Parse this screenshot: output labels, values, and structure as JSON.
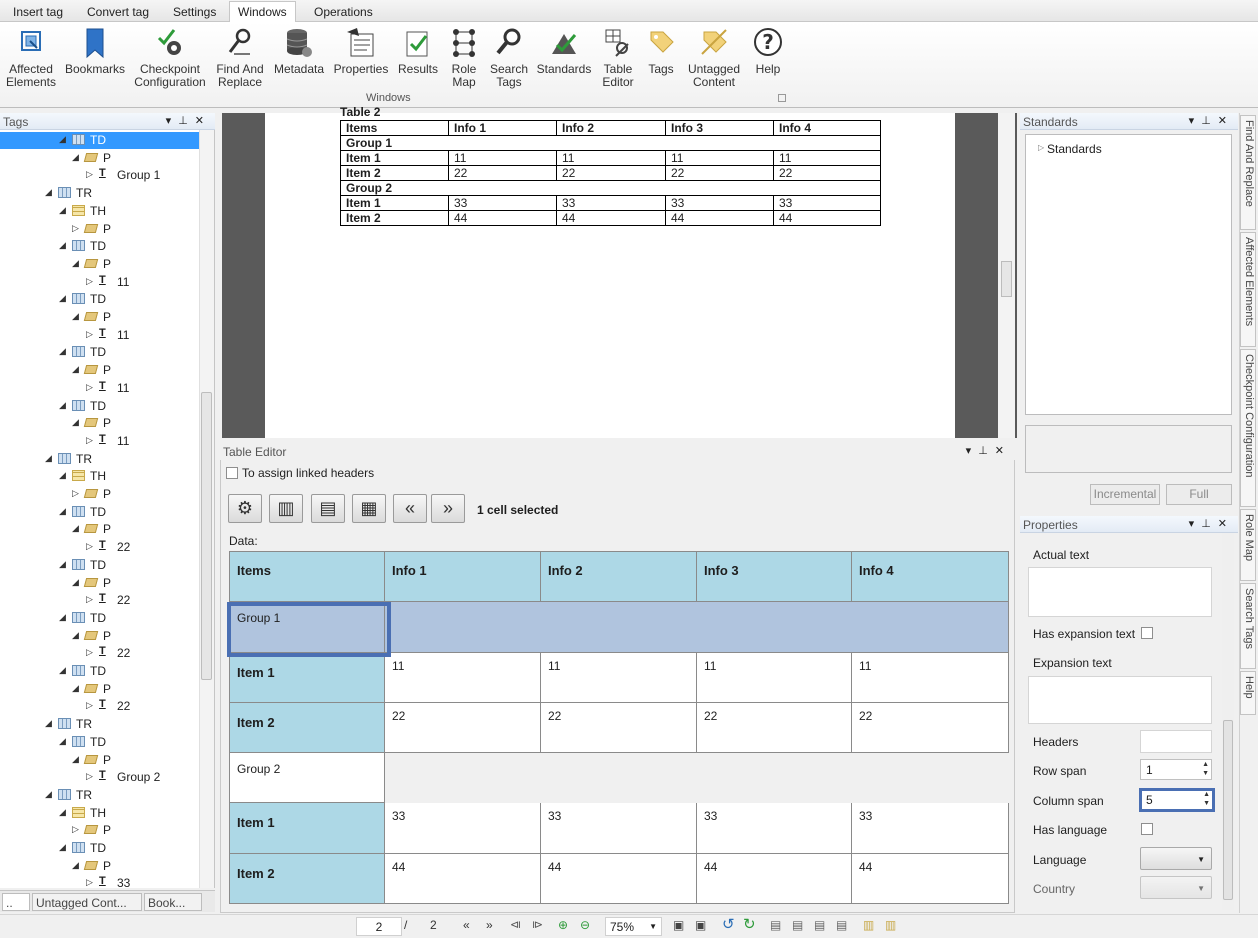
{
  "ribbon": {
    "tabs": [
      "Insert tag",
      "Convert tag",
      "Settings",
      "Windows",
      "Operations"
    ],
    "active_tab": "Windows",
    "buttons": [
      {
        "label": "Affected\nElements",
        "icon": "affected-elements-icon"
      },
      {
        "label": "Bookmarks",
        "icon": "bookmark-icon"
      },
      {
        "label": "Checkpoint\nConfiguration",
        "icon": "checkpoint-gear-icon"
      },
      {
        "label": "Find And\nReplace",
        "icon": "find-replace-icon"
      },
      {
        "label": "Metadata",
        "icon": "database-icon"
      },
      {
        "label": "Properties",
        "icon": "properties-icon"
      },
      {
        "label": "Results",
        "icon": "results-icon"
      },
      {
        "label": "Role\nMap",
        "icon": "role-map-icon"
      },
      {
        "label": "Search\nTags",
        "icon": "search-icon"
      },
      {
        "label": "Standards",
        "icon": "standards-icon"
      },
      {
        "label": "Table\nEditor",
        "icon": "table-editor-icon"
      },
      {
        "label": "Tags",
        "icon": "tags-icon"
      },
      {
        "label": "Untagged\nContent",
        "icon": "untagged-icon"
      },
      {
        "label": "Help",
        "icon": "help-icon"
      }
    ],
    "group_label": "Windows"
  },
  "tags_panel": {
    "title": "Tags",
    "rows": [
      {
        "type": "TD",
        "label": "TD",
        "level": 4,
        "expanded": true,
        "selected": true
      },
      {
        "type": "P",
        "label": "P",
        "level": 5,
        "expanded": true
      },
      {
        "type": "T",
        "label": "Group 1",
        "level": 6,
        "expanded": false
      },
      {
        "type": "TR",
        "label": "TR",
        "level": 3,
        "expanded": true
      },
      {
        "type": "TH",
        "label": "TH",
        "level": 4,
        "expanded": true
      },
      {
        "type": "P",
        "label": "P",
        "level": 5,
        "expanded": false
      },
      {
        "type": "TD",
        "label": "TD",
        "level": 4,
        "expanded": true
      },
      {
        "type": "P",
        "label": "P",
        "level": 5,
        "expanded": true
      },
      {
        "type": "T",
        "label": "11",
        "level": 6,
        "expanded": false
      },
      {
        "type": "TD",
        "label": "TD",
        "level": 4,
        "expanded": true
      },
      {
        "type": "P",
        "label": "P",
        "level": 5,
        "expanded": true
      },
      {
        "type": "T",
        "label": "11",
        "level": 6,
        "expanded": false
      },
      {
        "type": "TD",
        "label": "TD",
        "level": 4,
        "expanded": true
      },
      {
        "type": "P",
        "label": "P",
        "level": 5,
        "expanded": true
      },
      {
        "type": "T",
        "label": "11",
        "level": 6,
        "expanded": false
      },
      {
        "type": "TD",
        "label": "TD",
        "level": 4,
        "expanded": true
      },
      {
        "type": "P",
        "label": "P",
        "level": 5,
        "expanded": true
      },
      {
        "type": "T",
        "label": "11",
        "level": 6,
        "expanded": false
      },
      {
        "type": "TR",
        "label": "TR",
        "level": 3,
        "expanded": true
      },
      {
        "type": "TH",
        "label": "TH",
        "level": 4,
        "expanded": true
      },
      {
        "type": "P",
        "label": "P",
        "level": 5,
        "expanded": false
      },
      {
        "type": "TD",
        "label": "TD",
        "level": 4,
        "expanded": true
      },
      {
        "type": "P",
        "label": "P",
        "level": 5,
        "expanded": true
      },
      {
        "type": "T",
        "label": "22",
        "level": 6,
        "expanded": false
      },
      {
        "type": "TD",
        "label": "TD",
        "level": 4,
        "expanded": true
      },
      {
        "type": "P",
        "label": "P",
        "level": 5,
        "expanded": true
      },
      {
        "type": "T",
        "label": "22",
        "level": 6,
        "expanded": false
      },
      {
        "type": "TD",
        "label": "TD",
        "level": 4,
        "expanded": true
      },
      {
        "type": "P",
        "label": "P",
        "level": 5,
        "expanded": true
      },
      {
        "type": "T",
        "label": "22",
        "level": 6,
        "expanded": false
      },
      {
        "type": "TD",
        "label": "TD",
        "level": 4,
        "expanded": true
      },
      {
        "type": "P",
        "label": "P",
        "level": 5,
        "expanded": true
      },
      {
        "type": "T",
        "label": "22",
        "level": 6,
        "expanded": false
      },
      {
        "type": "TR",
        "label": "TR",
        "level": 3,
        "expanded": true
      },
      {
        "type": "TD",
        "label": "TD",
        "level": 4,
        "expanded": true
      },
      {
        "type": "P",
        "label": "P",
        "level": 5,
        "expanded": true
      },
      {
        "type": "T",
        "label": "Group 2",
        "level": 6,
        "expanded": false
      },
      {
        "type": "TR",
        "label": "TR",
        "level": 3,
        "expanded": true
      },
      {
        "type": "TH",
        "label": "TH",
        "level": 4,
        "expanded": true
      },
      {
        "type": "P",
        "label": "P",
        "level": 5,
        "expanded": false
      },
      {
        "type": "TD",
        "label": "TD",
        "level": 4,
        "expanded": true
      },
      {
        "type": "P",
        "label": "P",
        "level": 5,
        "expanded": true
      },
      {
        "type": "T",
        "label": "33",
        "level": 6,
        "expanded": false
      }
    ],
    "bottom_tabs": [
      "..",
      "Untagged Cont...",
      "Book..."
    ]
  },
  "document": {
    "heading_fragment": "Table 2",
    "rows": [
      [
        "Items",
        "Info 1",
        "Info 2",
        "Info 3",
        "Info 4"
      ],
      [
        "Group 1"
      ],
      [
        "Item 1",
        "11",
        "11",
        "11",
        "11"
      ],
      [
        "Item 2",
        "22",
        "22",
        "22",
        "22"
      ],
      [
        "Group 2"
      ],
      [
        "Item 1",
        "33",
        "33",
        "33",
        "33"
      ],
      [
        "Item 2",
        "44",
        "44",
        "44",
        "44"
      ]
    ]
  },
  "table_editor": {
    "title": "Table Editor",
    "assign_linked_headers": "To assign linked headers",
    "selection_status": "1 cell selected",
    "data_label": "Data:",
    "headers": [
      "Items",
      "Info 1",
      "Info 2",
      "Info 3",
      "Info 4"
    ],
    "rows": [
      {
        "kind": "group",
        "label": "Group 1",
        "selected": true
      },
      {
        "kind": "item",
        "label": "Item 1",
        "values": [
          "11",
          "11",
          "11",
          "11"
        ]
      },
      {
        "kind": "item",
        "label": "Item 2",
        "values": [
          "22",
          "22",
          "22",
          "22"
        ]
      },
      {
        "kind": "group",
        "label": "Group 2",
        "selected": false
      },
      {
        "kind": "item",
        "label": "Item 1",
        "values": [
          "33",
          "33",
          "33",
          "33"
        ]
      },
      {
        "kind": "item",
        "label": "Item 2",
        "values": [
          "44",
          "44",
          "44",
          "44"
        ]
      }
    ],
    "colors": {
      "header": "#add8e6",
      "selected_row": "#b0c4de",
      "selection_border": "#4a6fb3"
    }
  },
  "standards": {
    "title": "Standards",
    "tree_root": "Standards",
    "incremental": "Incremental",
    "full": "Full"
  },
  "properties": {
    "title": "Properties",
    "actual_text": "Actual text",
    "has_expansion_text": "Has expansion text",
    "expansion_text": "Expansion text",
    "headers": "Headers",
    "row_span_label": "Row span",
    "row_span": "1",
    "column_span_label": "Column span",
    "column_span": "5",
    "has_language": "Has language",
    "language": "Language",
    "country": "Country"
  },
  "side_tabs": [
    "Find And Replace",
    "Affected Elements",
    "Checkpoint Configuration",
    "Role Map",
    "Search Tags",
    "Help"
  ],
  "statusbar": {
    "page": "2",
    "separator": "/",
    "total_pages": "2",
    "zoom": "75%"
  }
}
